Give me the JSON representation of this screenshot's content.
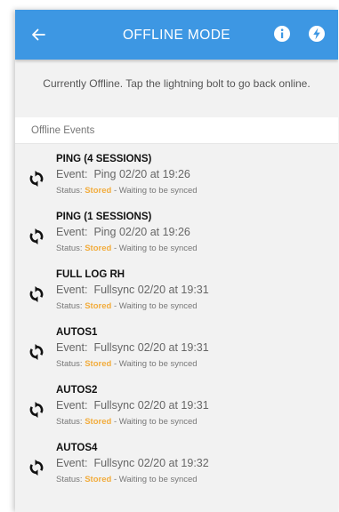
{
  "appbar": {
    "title": "OFFLINE MODE",
    "back_icon": "arrow-left-icon",
    "info_icon": "info-icon",
    "bolt_icon": "lightning-bolt-icon",
    "color": "#3d97e3"
  },
  "notice": "Currently Offline. Tap the lightning bolt to go back online.",
  "events_header": "Offline Events",
  "status_label": "Status:",
  "status_color": "#f2ac3c",
  "event_label": "Event:",
  "events": [
    {
      "name": "PING (4 SESSIONS)",
      "type": "Ping",
      "when": "02/20 at 19:26",
      "status": "Stored",
      "note": "- Waiting to be synced"
    },
    {
      "name": "PING (1 SESSIONS)",
      "type": "Ping",
      "when": "02/20 at 19:26",
      "status": "Stored",
      "note": "- Waiting to be synced"
    },
    {
      "name": "FULL LOG RH",
      "type": "Fullsync",
      "when": "02/20 at 19:31",
      "status": "Stored",
      "note": "- Waiting to be synced"
    },
    {
      "name": "AUTOS1",
      "type": "Fullsync",
      "when": "02/20 at 19:31",
      "status": "Stored",
      "note": "- Waiting to be synced"
    },
    {
      "name": "AUTOS2",
      "type": "Fullsync",
      "when": "02/20 at 19:31",
      "status": "Stored",
      "note": "- Waiting to be synced"
    },
    {
      "name": "AUTOS4",
      "type": "Fullsync",
      "when": "02/20 at 19:32",
      "status": "Stored",
      "note": "- Waiting to be synced"
    }
  ]
}
